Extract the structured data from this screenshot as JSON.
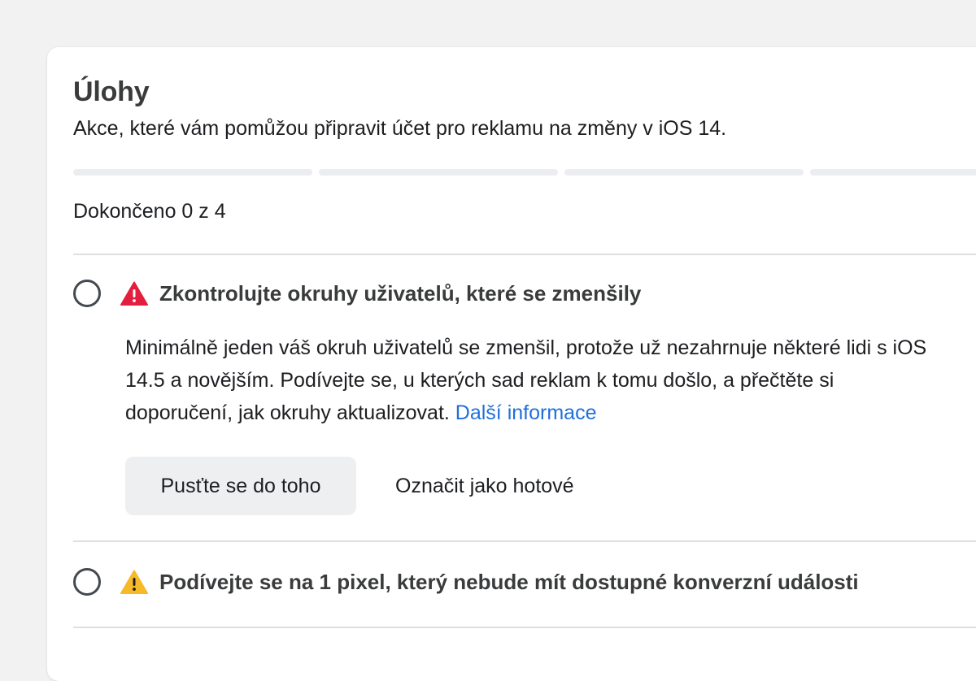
{
  "tasks_card": {
    "title": "Úlohy",
    "subtitle": "Akce, které vám pomůžou připravit účet pro reklamu na změny v iOS 14.",
    "progress": {
      "completed": 0,
      "total": 4,
      "label": "Dokončeno 0 z 4"
    },
    "tasks": [
      {
        "title": "Zkontrolujte okruhy uživatelů, které se zmenšily",
        "severity": "error",
        "icon": "error-triangle-icon",
        "description": "Minimálně jeden váš okruh uživatelů se zmenšil, protože už nezahrnuje některé lidi s iOS 14.5 a novějším. Podívejte se, u kterých sad reklam k tomu došlo, a přečtěte si doporučení, jak okruhy aktualizovat.",
        "link_label": "Další informace",
        "primary_button": "Pusťte se do toho",
        "secondary_button": "Označit jako hotové",
        "checked": false
      },
      {
        "title": "Podívejte se na 1 pixel, který nebude mít dostupné konverzní události",
        "severity": "warning",
        "icon": "warning-triangle-icon",
        "checked": false
      }
    ]
  },
  "colors": {
    "error": "#e41e3f",
    "warning": "#f7b928",
    "link": "#216fdb",
    "progress_track": "#ebedf0"
  }
}
